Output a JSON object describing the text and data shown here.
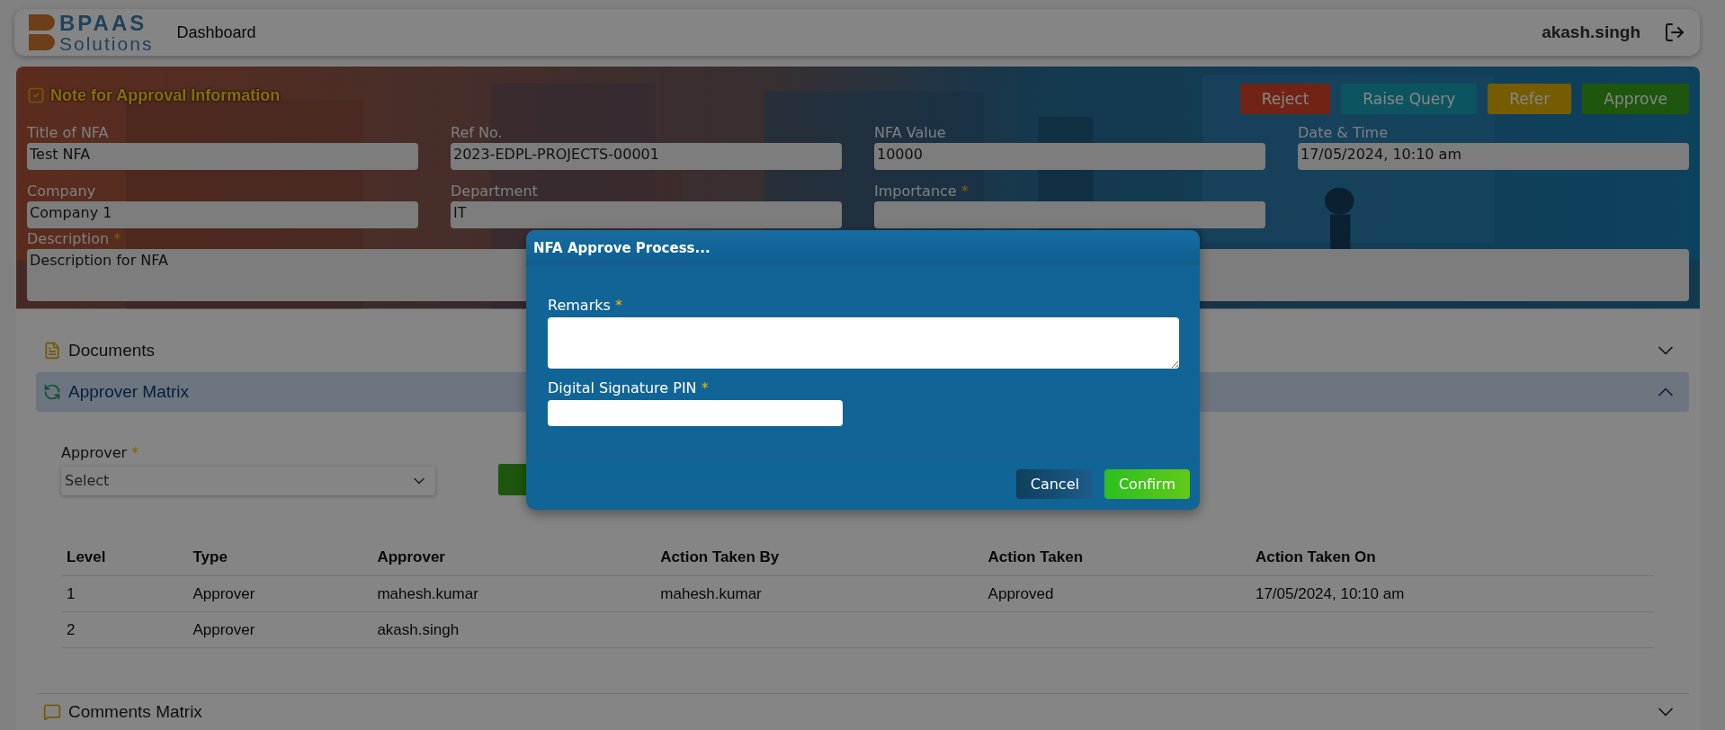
{
  "header": {
    "logo": {
      "line_1": "BPAAS",
      "line_2": "Solutions"
    },
    "nav": "Dashboard",
    "user": "akash.singh"
  },
  "info": {
    "title": "Note for Approval Information",
    "actions": [
      {
        "label": "Reject",
        "kind": "reject"
      },
      {
        "label": "Raise Query",
        "kind": "query"
      },
      {
        "label": "Refer",
        "kind": "refer"
      },
      {
        "label": "Approve",
        "kind": "approve"
      }
    ],
    "fields": [
      {
        "label": "Title of NFA",
        "value": "Test NFA"
      },
      {
        "label": "Ref No.",
        "value": "2023-EDPL-PROJECTS-00001"
      },
      {
        "label": "NFA Value",
        "value": "10000"
      },
      {
        "label": "Date & Time",
        "value": "17/05/2024, 10:10 am"
      },
      {
        "label": "Company",
        "value": "Company 1"
      },
      {
        "label": "Department",
        "value": "IT"
      },
      {
        "label": "Importance",
        "required_mark": "*"
      }
    ],
    "description": {
      "label": "Description",
      "required_mark": "*",
      "value": "Description for NFA"
    }
  },
  "sections": [
    {
      "title": "Documents",
      "kind": "documents",
      "expanded": false
    },
    {
      "title": "Approver Matrix",
      "kind": "matrix",
      "expanded": true,
      "form": {
        "label": "Approver",
        "required_mark": "*",
        "value": "Select"
      },
      "table": {
        "columns": [
          "Level",
          "Type",
          "Approver",
          "Action Taken By",
          "Action Taken",
          "Action Taken On"
        ],
        "rows": [
          [
            "1",
            "Approver",
            "mahesh.kumar",
            "mahesh.kumar",
            "Approved",
            "17/05/2024, 10:10 am"
          ],
          [
            "2",
            "Approver",
            "akash.singh",
            "",
            "",
            ""
          ]
        ]
      }
    },
    {
      "title": "Comments Matrix",
      "kind": "comments",
      "expanded": false
    }
  ],
  "modal": {
    "title": "NFA Approve Process...",
    "fields": [
      {
        "label": "Remarks",
        "required_mark": "*",
        "kind": "textarea"
      },
      {
        "label": "Digital Signature PIN",
        "required_mark": "*",
        "kind": "input"
      }
    ],
    "buttons": [
      {
        "label": "Cancel",
        "kind": "cancel"
      },
      {
        "label": "Confirm",
        "kind": "confirm"
      }
    ]
  }
}
